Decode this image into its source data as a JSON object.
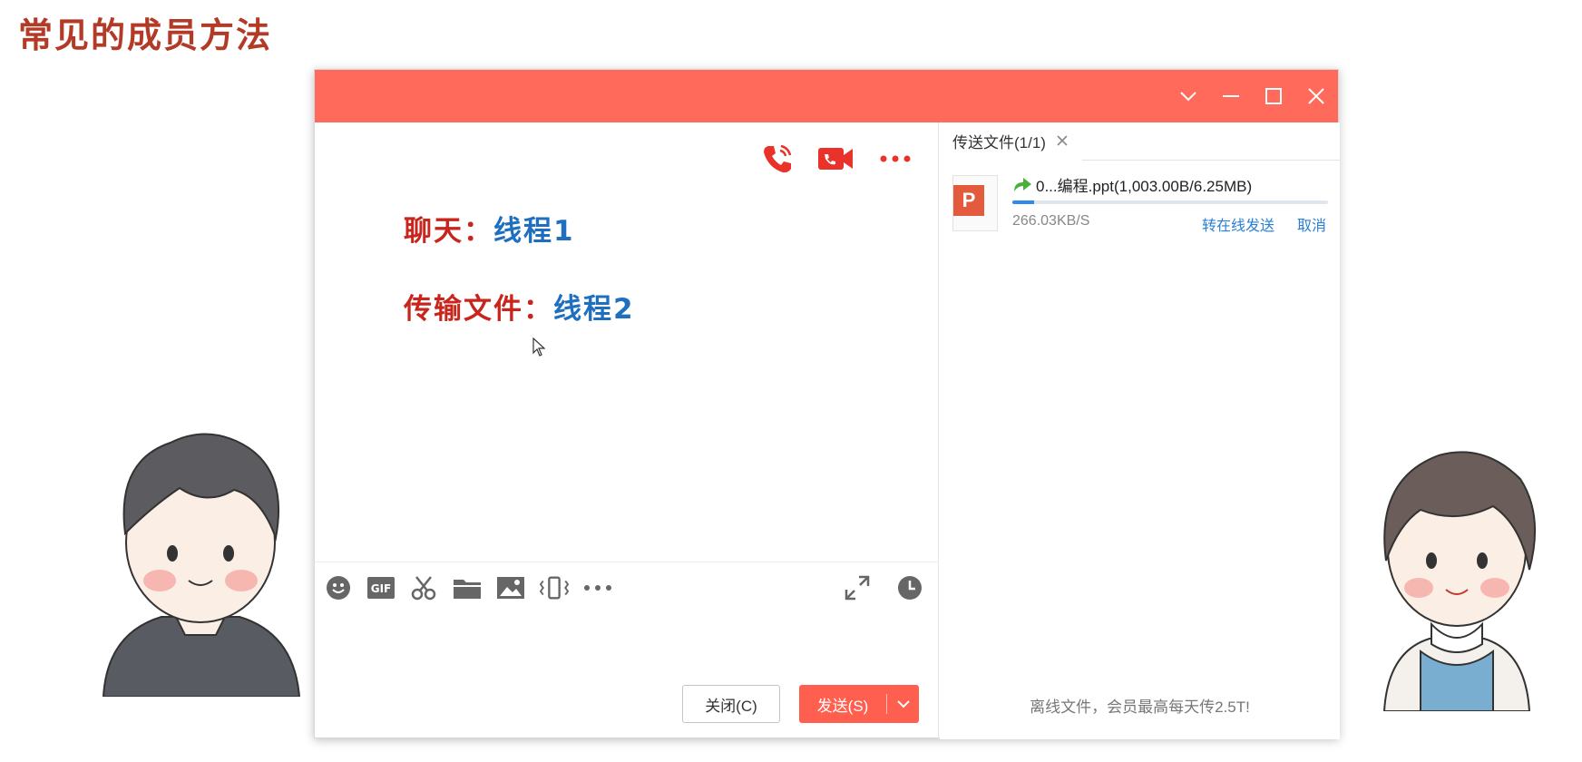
{
  "slide": {
    "title": "常见的成员方法"
  },
  "window": {
    "titlebar_color": "#ff6a5a",
    "controls": [
      "chevron-down-icon",
      "minimize-icon",
      "maximize-icon",
      "close-icon"
    ]
  },
  "chat": {
    "header_icons": [
      "phone-call-icon",
      "video-call-icon",
      "more-icon"
    ],
    "messages": [
      {
        "label": "聊天：",
        "value": "线程1"
      },
      {
        "label": "传输文件：",
        "value": "线程2"
      }
    ],
    "toolbar_icons": [
      "emoji-icon",
      "gif-icon",
      "scissors-icon",
      "folder-icon",
      "image-icon",
      "shake-icon",
      "more-tools-icon",
      "expand-icon",
      "history-icon"
    ],
    "close_button": "关闭(C)",
    "send_button": "发送(S)"
  },
  "file_transfer": {
    "tab_label": "传送文件(1/1)",
    "file_name": "0...编程.ppt(1,003.00B/6.25MB)",
    "file_type": "P",
    "progress": 0.07,
    "speed": "266.03KB/S",
    "offline_link": "转在线发送",
    "cancel_link": "取消",
    "offline_note": "离线文件，会员最高每天传2.5T!"
  },
  "colors": {
    "accent": "#ff6a5a",
    "send": "#ff5f4f",
    "link": "#2a7fd4",
    "message_label": "#c8261c",
    "message_value": "#1f6fc0",
    "title": "#b23a26"
  }
}
